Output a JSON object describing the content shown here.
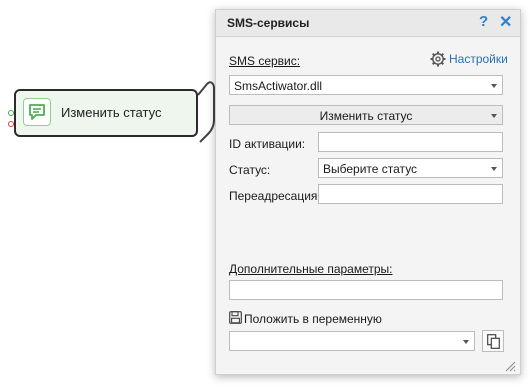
{
  "node": {
    "label": "Изменить статус",
    "icon": "chat-message-icon",
    "accent": "#4caf50"
  },
  "panel": {
    "title": "SMS-сервисы",
    "help_icon": "question-icon",
    "close_icon": "close-icon",
    "help_glyph": "?",
    "close_glyph": "✕",
    "sms_service_label": "SMS сервис:",
    "settings_label": "Настройки",
    "sms_service_value": "SmsActiwator.dll",
    "action_value": "Изменить статус",
    "activation_id_label": "ID активации:",
    "activation_id_value": "",
    "status_label": "Статус:",
    "status_value": "Выберите статус",
    "forward_label": "Переадресация:",
    "forward_value": "",
    "extra_params_label": "Дополнительные параметры:",
    "extra_params_value": "",
    "save_to_var_label": "Положить в переменную",
    "save_to_var_value": ""
  },
  "colors": {
    "link": "#2a6fb5",
    "title_icons": "#2f7fcf",
    "port_in": "#45a845",
    "port_error": "#d43c3c"
  }
}
